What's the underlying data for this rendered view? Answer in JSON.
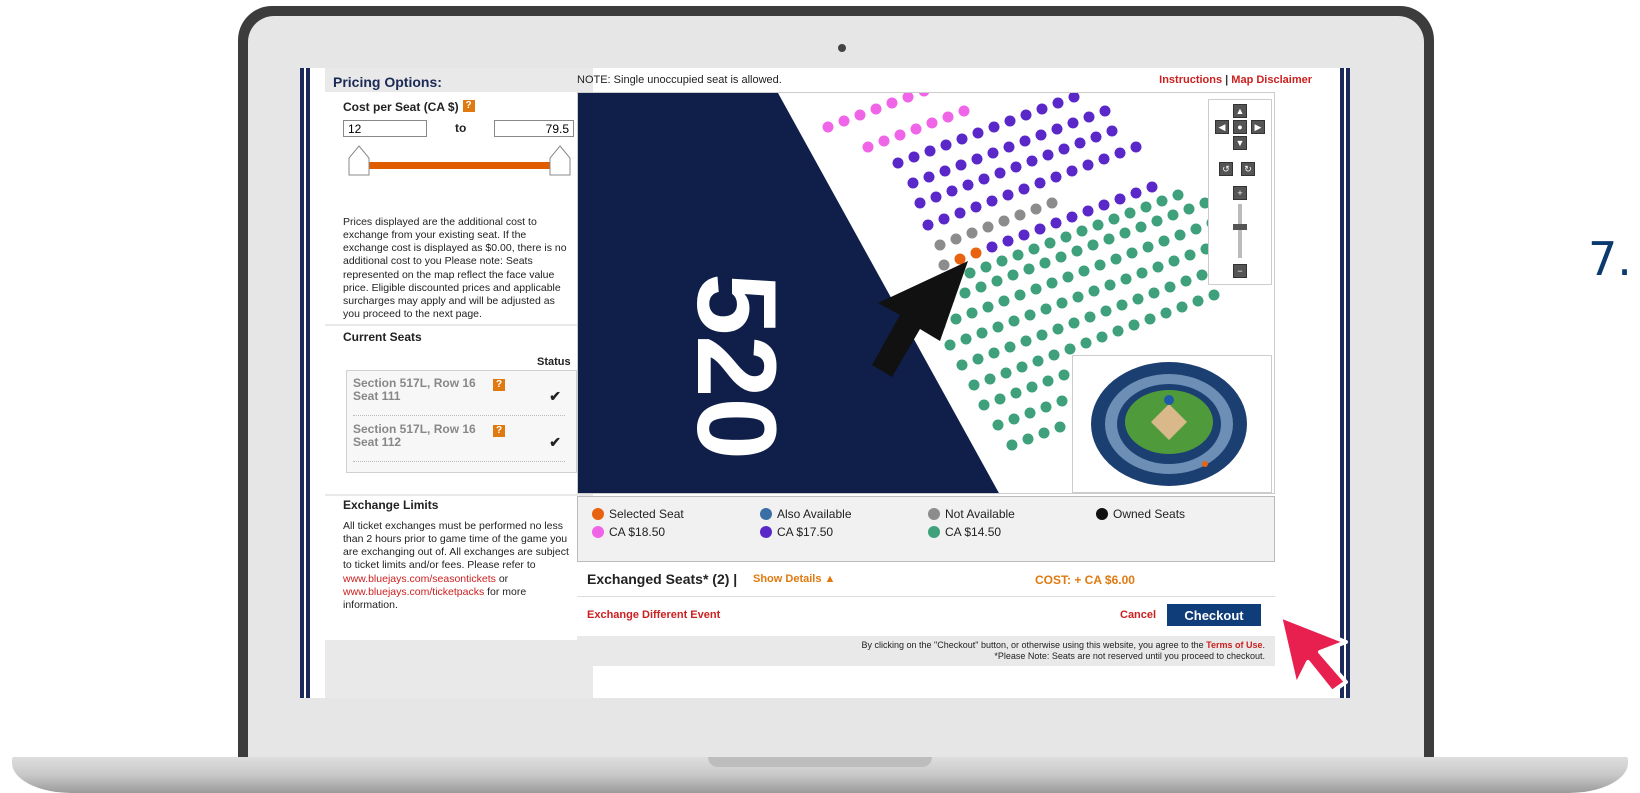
{
  "step_label": "7.",
  "pricing": {
    "title": "Pricing Options:",
    "cost_label": "Cost per Seat (CA $)",
    "help_glyph": "?",
    "min_value": "12",
    "to_label": "to",
    "max_value": "79.5",
    "info_text": "Prices displayed are the additional cost to exchange from your existing seat. If the exchange cost is displayed as $0.00, there is no additional cost to you Please note: Seats represented on the map reflect the face value price. Eligible discounted prices and applicable surcharges may apply and will be adjusted as you proceed to the next page."
  },
  "current_seats": {
    "title": "Current Seats",
    "status_header": "Status",
    "seats": [
      {
        "line1": "Section 517L, Row 16",
        "line2": "Seat 111",
        "status": "✔"
      },
      {
        "line1": "Section 517L, Row 16",
        "line2": "Seat 112",
        "status": "✔"
      }
    ]
  },
  "exchange_limits": {
    "title": "Exchange Limits",
    "text": "All ticket exchanges must be performed no less than 2 hours prior to game time of the game you are exchanging out of. All exchanges are subject to ticket limits and/or fees. Please refer to",
    "link1": "www.bluejays.com/seasontickets",
    "or": " or",
    "link2": "www.bluejays.com/ticketpacks",
    "tail": " for more information."
  },
  "map": {
    "note": "NOTE: Single unoccupied seat is allowed.",
    "instructions_link": "Instructions",
    "separator": "|",
    "disclaimer_link": "Map Disclaimer",
    "section_number": "520"
  },
  "legend": [
    {
      "label": "Selected Seat",
      "color": "#e8620f"
    },
    {
      "label": "Also Available",
      "color": "#3a6ea5"
    },
    {
      "label": "Not Available",
      "color": "#8c8c8c"
    },
    {
      "label": "Owned Seats",
      "color": "#111111"
    },
    {
      "label": "CA $18.50",
      "color": "#f065e8"
    },
    {
      "label": "CA $17.50",
      "color": "#5a28c8"
    },
    {
      "label": "CA $14.50",
      "color": "#3fa07c"
    }
  ],
  "summary": {
    "exchanged_label": "Exchanged Seats* (2) |",
    "show_details": "Show Details ▲",
    "cost": "COST: + CA $6.00",
    "exchange_different": "Exchange Different Event",
    "cancel": "Cancel",
    "checkout": "Checkout",
    "footer_line1": "By clicking on the \"Checkout\" button, or otherwise using this website, you agree to the",
    "terms_link": "Terms of Use",
    "footer_line2": "*Please Note: Seats are not reserved until you proceed to checkout."
  },
  "colors": {
    "navy": "#0f1f4a",
    "accent_orange": "#e05c00",
    "link_red": "#cc1f1f",
    "cursor_pink": "#e8204f"
  }
}
